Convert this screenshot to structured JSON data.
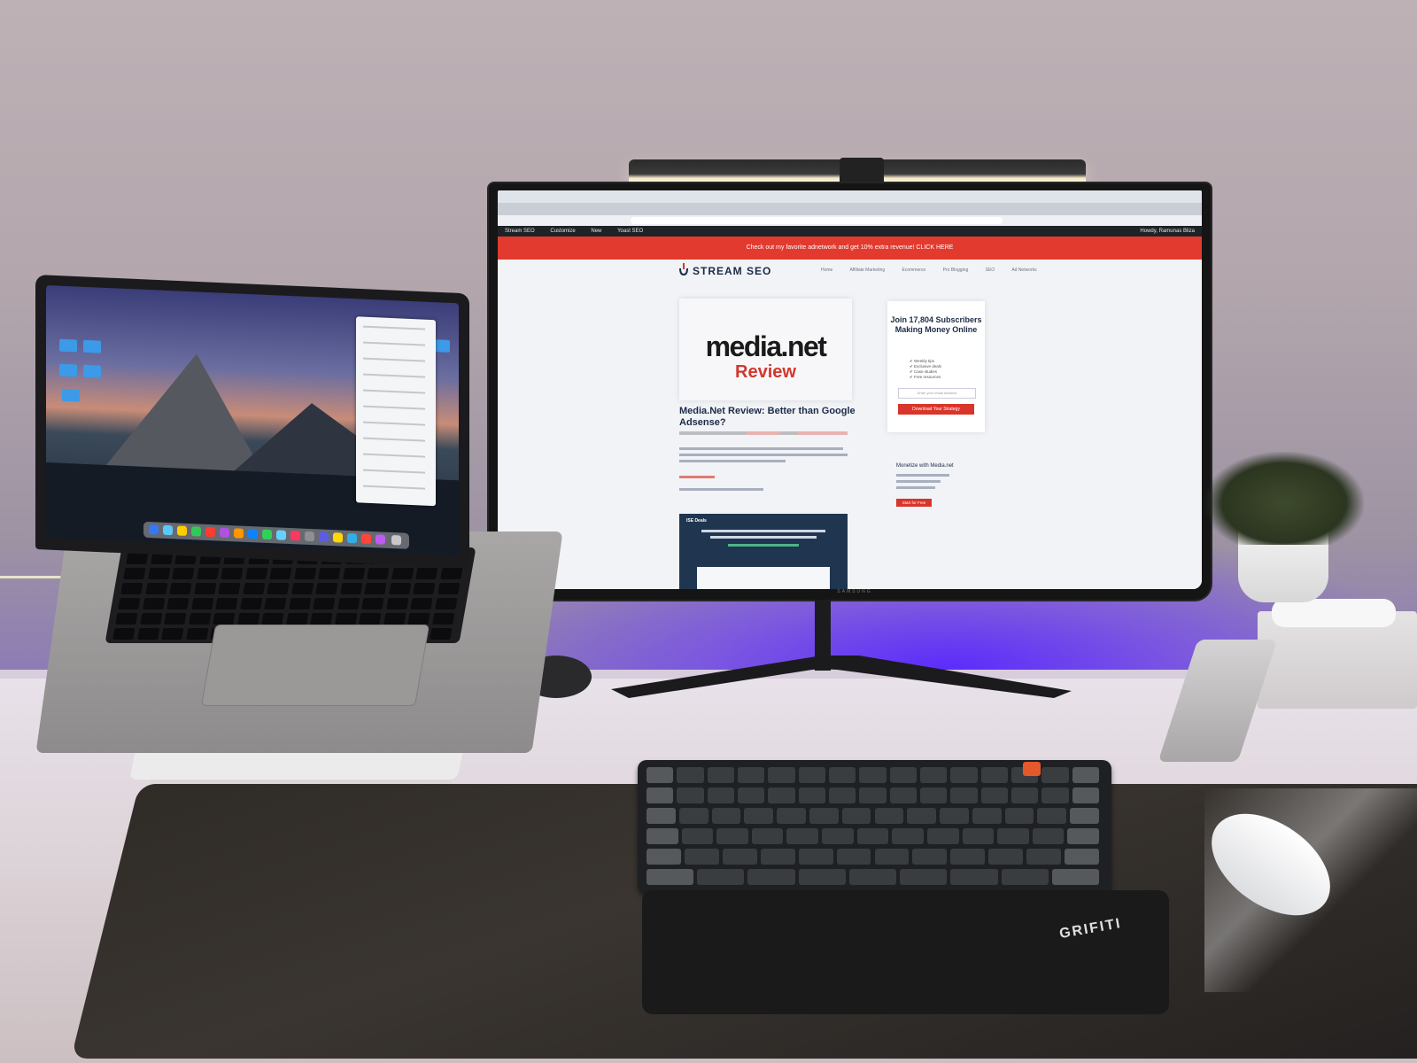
{
  "monitor": {
    "wp_bar": [
      "Stream SEO",
      "Customize",
      "New",
      "Yoast SEO",
      "Howdy, Ramunas Bliza"
    ],
    "promo_text": "Check out my favorite adnetwork and get 10% extra revenue! CLICK HERE",
    "site_logo": "STREAM SEO",
    "nav": [
      "Home",
      "Affiliate Marketing",
      "Ecommerce",
      "Pro Blogging",
      "SEO",
      "Ad Networks"
    ],
    "hero_title": "media.net",
    "hero_subtitle": "Review",
    "post_title": "Media.Net Review: Better than Google Adsense?",
    "sidebar_heading": "Join 17,804 Subscribers Making Money Online",
    "sidebar_list": [
      "✔ Weekly tips",
      "✔ Exclusive deals",
      "✔ Case studies",
      "✔ Free resources"
    ],
    "sidebar_input_placeholder": "Enter your email address",
    "sidebar_button": "Download Your Strategy",
    "sidebar2_label": "Monetize with Media.net",
    "sidebar2_button": "Start for Free",
    "ad_title": "ISE Deals",
    "stand_brand": "SAMSUNG"
  },
  "wrist_rest_brand": "GRIFITI",
  "colors": {
    "accent_red": "#e23a2e",
    "underglow": "#5a28ff",
    "site_navy": "#1c2b46"
  }
}
